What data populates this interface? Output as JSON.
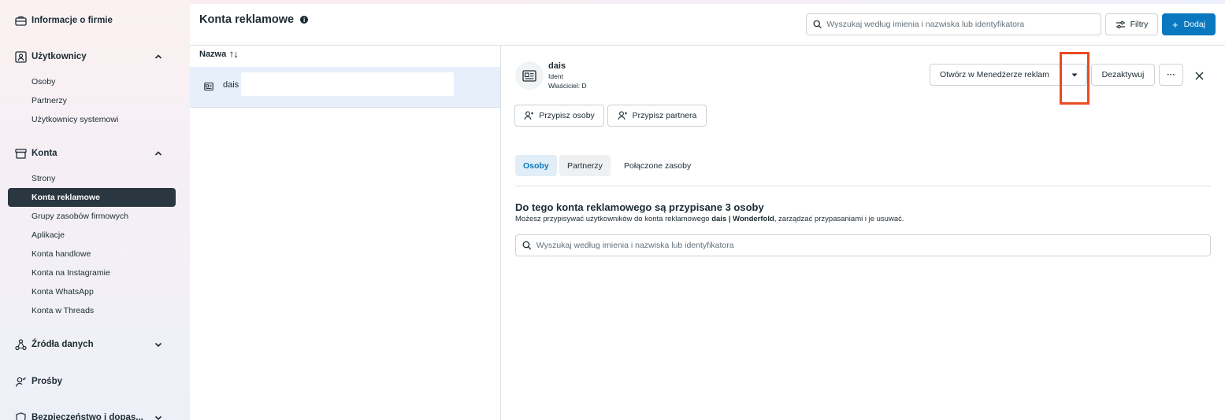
{
  "sidebar": {
    "company_info": "Informacje o firmie",
    "users": {
      "label": "Użytkownicy",
      "items": [
        "Osoby",
        "Partnerzy",
        "Użytkownicy systemowi"
      ]
    },
    "accounts": {
      "label": "Konta",
      "items": [
        "Strony",
        "Konta reklamowe",
        "Grupy zasobów firmowych",
        "Aplikacje",
        "Konta handlowe",
        "Konta na Instagramie",
        "Konta WhatsApp",
        "Konta w Threads"
      ],
      "active_index": 1
    },
    "data_sources": "Źródła danych",
    "requests": "Prośby",
    "security": "Bezpieczeństwo i dopas..."
  },
  "header": {
    "title": "Konta reklamowe",
    "search_placeholder": "Wyszukaj według imienia i nazwiska lub identyfikatora",
    "filters_label": "Filtry",
    "add_label": "Dodaj"
  },
  "list": {
    "column_name": "Nazwa",
    "rows": [
      {
        "name": "dais"
      }
    ]
  },
  "detail": {
    "name": "dais",
    "id_label": "Ident",
    "owner_label": "Właściciel: D",
    "open_manager_label": "Otwórz w Menedżerze reklam",
    "deactivate_label": "Dezaktywuj",
    "more_label": "···",
    "assign_people_label": "Przypisz osoby",
    "assign_partner_label": "Przypisz partnera",
    "tabs": [
      "Osoby",
      "Partnerzy",
      "Połączone zasoby"
    ],
    "section_title": "Do tego konta reklamowego są przypisane 3 osoby",
    "section_desc_prefix": "Możesz przypisywać użytkowników do konta reklamowego ",
    "section_desc_bold": "dais | Wonderfold",
    "section_desc_suffix": ", zarządzać przypasaniami i je usuwać.",
    "people_search_placeholder": "Wyszukaj według imienia i nazwiska lub identyfikatora"
  },
  "colors": {
    "accent": "#0a78be",
    "active_nav": "#2a3640",
    "highlight_box": "#ea4a23"
  }
}
